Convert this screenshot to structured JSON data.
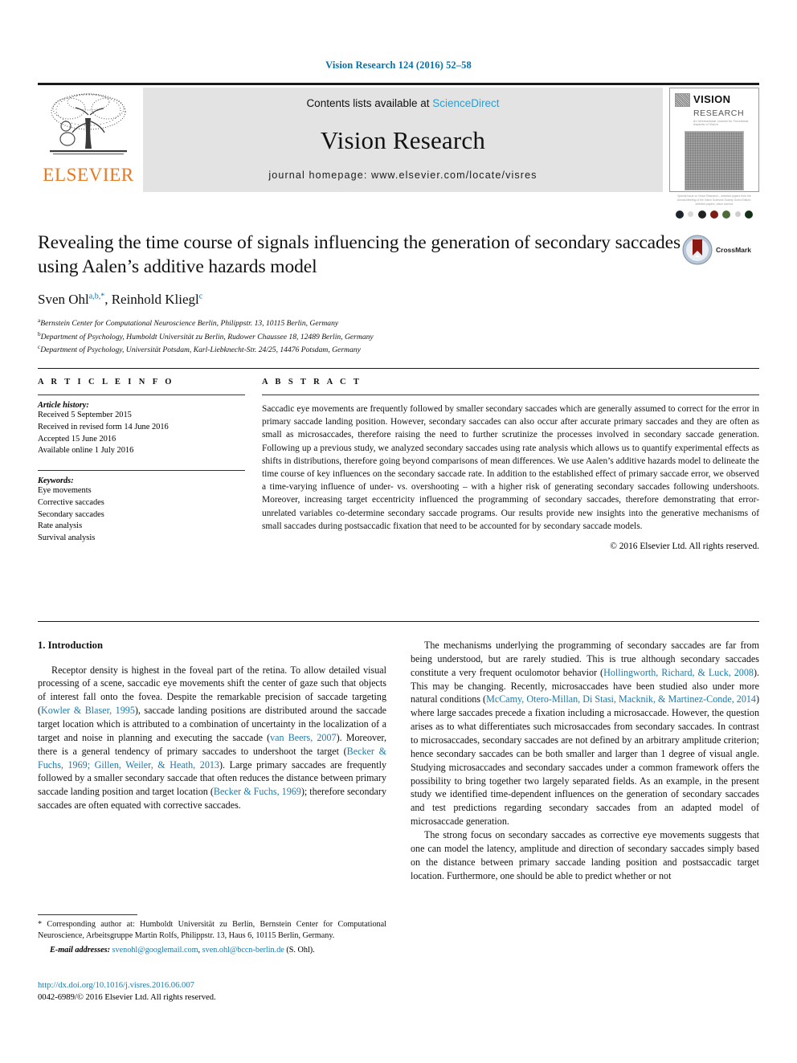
{
  "running_head": "Vision Research 124 (2016) 52–58",
  "masthead": {
    "publisher": "ELSEVIER",
    "contents_prefix": "Contents lists available at ",
    "contents_link": "ScienceDirect",
    "journal_name": "Vision Research",
    "homepage": "journal homepage: www.elsevier.com/locate/visres",
    "cover": {
      "title_line1": "VISION",
      "title_line2": "RESEARCH",
      "subtitle": "An International Journal for Functional Aspects of Vision",
      "caption": "Special Issue on Vision Research – selected papers\nfrom the Annual Meeting of the Vision Sciences Society\nGuest Editors: selected papers, vision science"
    }
  },
  "article": {
    "title": "Revealing the time course of signals influencing the generation of secondary saccades using Aalen’s additive hazards model",
    "crossmark_label": "CrossMark",
    "authors": [
      {
        "name": "Sven Ohl",
        "sup": "a,b,*"
      },
      {
        "name": "Reinhold Kliegl",
        "sup": "c"
      }
    ],
    "authors_separator": ", ",
    "affiliations": [
      {
        "mark": "a",
        "text": "Bernstein Center for Computational Neuroscience Berlin, Philippstr. 13, 10115 Berlin, Germany"
      },
      {
        "mark": "b",
        "text": "Department of Psychology, Humboldt Universität zu Berlin, Rudower Chaussee 18, 12489 Berlin, Germany"
      },
      {
        "mark": "c",
        "text": "Department of Psychology, Universität Potsdam, Karl-Liebknecht-Str. 24/25, 14476 Potsdam, Germany"
      }
    ]
  },
  "article_info": {
    "heading": "A R T I C L E  I N F O",
    "history_title": "Article history:",
    "history": [
      "Received 5 September 2015",
      "Received in revised form 14 June 2016",
      "Accepted 15 June 2016",
      "Available online 1 July 2016"
    ],
    "keywords_title": "Keywords:",
    "keywords": [
      "Eye movements",
      "Corrective saccades",
      "Secondary saccades",
      "Rate analysis",
      "Survival analysis"
    ]
  },
  "abstract": {
    "heading": "A B S T R A C T",
    "text": "Saccadic eye movements are frequently followed by smaller secondary saccades which are generally assumed to correct for the error in primary saccade landing position. However, secondary saccades can also occur after accurate primary saccades and they are often as small as microsaccades, therefore raising the need to further scrutinize the processes involved in secondary saccade generation. Following up a previous study, we analyzed secondary saccades using rate analysis which allows us to quantify experimental effects as shifts in distributions, therefore going beyond comparisons of mean differences. We use Aalen’s additive hazards model to delineate the time course of key influences on the secondary saccade rate. In addition to the established effect of primary saccade error, we observed a time-varying influence of under- vs. overshooting – with a higher risk of generating secondary saccades following undershoots. Moreover, increasing target eccentricity influenced the programming of secondary saccades, therefore demonstrating that error-unrelated variables co-determine secondary saccade programs. Our results provide new insights into the generative mechanisms of small saccades during postsaccadic fixation that need to be accounted for by secondary saccade models.",
    "copyright": "© 2016 Elsevier Ltd. All rights reserved."
  },
  "body": {
    "section_heading": "1. Introduction",
    "left_paragraphs": [
      {
        "parts": [
          {
            "t": "Receptor density is highest in the foveal part of the retina. To allow detailed visual processing of a scene, saccadic eye movements shift the center of gaze such that objects of interest fall onto the fovea. Despite the remarkable precision of saccade targeting ("
          },
          {
            "t": "Kowler & Blaser, 1995",
            "ref": true
          },
          {
            "t": "), saccade landing positions are distributed around the saccade target location which is attributed to a combination of uncertainty in the localization of a target and noise in planning and executing the saccade ("
          },
          {
            "t": "van Beers, 2007",
            "ref": true
          },
          {
            "t": "). Moreover, there is a general tendency of primary saccades to undershoot the target ("
          },
          {
            "t": "Becker & Fuchs, 1969; Gillen, Weiler, & Heath, 2013",
            "ref": true
          },
          {
            "t": "). Large primary saccades are frequently followed by a smaller secondary saccade that often reduces the distance between primary saccade landing position and target location ("
          },
          {
            "t": "Becker & Fuchs, 1969",
            "ref": true
          },
          {
            "t": "); therefore secondary saccades are often equated with corrective saccades."
          }
        ]
      }
    ],
    "right_paragraphs": [
      {
        "parts": [
          {
            "t": "The mechanisms underlying the programming of secondary saccades are far from being understood, but are rarely studied. This is true although secondary saccades constitute a very frequent oculomotor behavior ("
          },
          {
            "t": "Hollingworth, Richard, & Luck, 2008",
            "ref": true
          },
          {
            "t": "). This may be changing. Recently, microsaccades have been studied also under more natural conditions ("
          },
          {
            "t": "McCamy, Otero-Millan, Di Stasi, Macknik, & Martinez-Conde, 2014",
            "ref": true
          },
          {
            "t": ") where large saccades precede a fixation including a microsaccade. However, the question arises as to what differentiates such microsaccades from secondary saccades. In contrast to microsaccades, secondary saccades are not defined by an arbitrary amplitude criterion; hence secondary saccades can be both smaller and larger than 1 degree of visual angle. Studying microsaccades and secondary saccades under a common framework offers the possibility to bring together two largely separated fields. As an example, in the present study we identified time-dependent influences on the generation of secondary saccades and test predictions regarding secondary saccades from an adapted model of microsaccade generation."
          }
        ]
      },
      {
        "parts": [
          {
            "t": "The strong focus on secondary saccades as corrective eye movements suggests that one can model the latency, amplitude and direction of secondary saccades simply based on the distance between primary saccade landing position and postsaccadic target location. Furthermore, one should be able to predict whether or not"
          }
        ]
      }
    ]
  },
  "footnotes": {
    "corresponding": "* Corresponding author at: Humboldt Universität zu Berlin, Bernstein Center for Computational Neuroscience, Arbeitsgruppe Martin Rolfs, Philippstr. 13, Haus 6, 10115 Berlin, Germany.",
    "email_label": "E-mail addresses:",
    "email_1": "svenohl@googlemail.com",
    "email_sep": ", ",
    "email_2": "sven.ohl@bccn-berlin.de",
    "email_suffix": " (S. Ohl).",
    "doi": "http://dx.doi.org/10.1016/j.visres.2016.06.007",
    "issn_line": "0042-6989/© 2016 Elsevier Ltd. All rights reserved."
  },
  "colors": {
    "link": "#1f7aa8",
    "sciencedirect": "#2a9fd0",
    "elsevier_orange": "#e87722",
    "running_head": "#0a70a8"
  }
}
